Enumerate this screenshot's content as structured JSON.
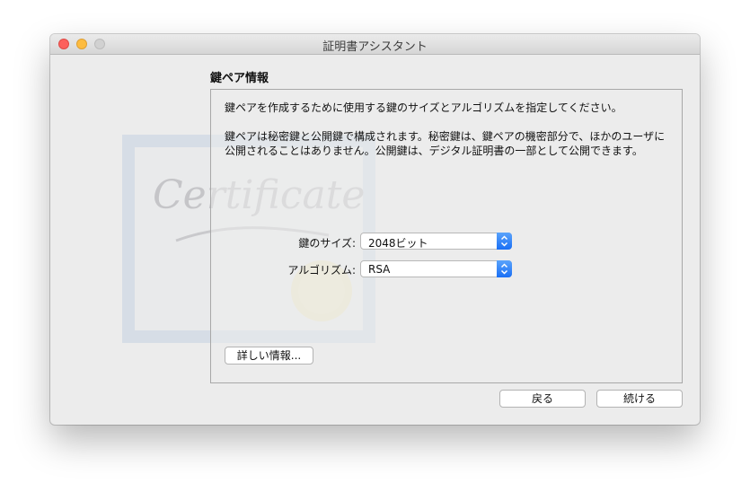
{
  "window": {
    "title": "証明書アシスタント"
  },
  "background_image": {
    "watermark_text": "Certificate"
  },
  "section": {
    "title": "鍵ペア情報"
  },
  "panel": {
    "intro": "鍵ペアを作成するために使用する鍵のサイズとアルゴリズムを指定してください。",
    "description_line1": "鍵ペアは秘密鍵と公開鍵で構成されます。秘密鍵は、鍵ペアの機密部分で、ほかのユーザに",
    "description_line2": "公開されることはありません。公開鍵は、デジタル証明書の一部として公開できます。",
    "key_size": {
      "label": "鍵のサイズ:",
      "value": "2048ビット"
    },
    "algorithm": {
      "label": "アルゴリズム:",
      "value": "RSA"
    },
    "details_button": "詳しい情報..."
  },
  "footer": {
    "back_button": "戻る",
    "continue_button": "続ける"
  },
  "colors": {
    "accent": "#1a6ff5",
    "close": "#fc605c",
    "minimize": "#fdbc40",
    "zoom_disabled": "#d1d1d1"
  }
}
